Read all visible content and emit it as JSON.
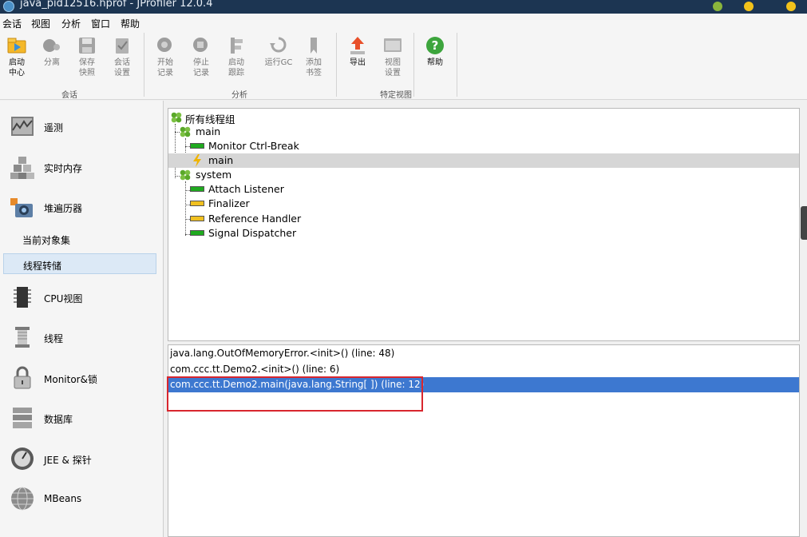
{
  "window": {
    "title": "java_pid12516.hprof - JProfiler 12.0.4"
  },
  "menubar": {
    "items": [
      "会话",
      "视图",
      "分析",
      "窗口",
      "帮助"
    ]
  },
  "toolbar": {
    "buttons": [
      {
        "label": "启动\n中心",
        "icon": "start-center-icon",
        "enabled": true
      },
      {
        "label": "分离",
        "icon": "detach-icon",
        "enabled": false
      },
      {
        "label": "保存\n快照",
        "icon": "save-snapshot-icon",
        "enabled": false
      },
      {
        "label": "会话\n设置",
        "icon": "session-settings-icon",
        "enabled": false
      },
      {
        "label": "开始\n记录",
        "icon": "start-recording-icon",
        "enabled": false
      },
      {
        "label": "停止\n记录",
        "icon": "stop-recording-icon",
        "enabled": false
      },
      {
        "label": "启动\n跟踪",
        "icon": "start-tracking-icon",
        "enabled": false
      },
      {
        "label": "运行GC",
        "icon": "run-gc-icon",
        "enabled": false
      },
      {
        "label": "添加\n书签",
        "icon": "add-bookmark-icon",
        "enabled": false
      },
      {
        "label": "导出",
        "icon": "export-icon",
        "enabled": true
      },
      {
        "label": "视图\n设置",
        "icon": "view-settings-icon",
        "enabled": false
      },
      {
        "label": "帮助",
        "icon": "help-icon",
        "enabled": true
      }
    ],
    "groups": [
      "会话",
      "分析",
      "特定视图"
    ]
  },
  "sidebar": {
    "items": [
      {
        "label": "遥测",
        "icon": "telemetry-icon"
      },
      {
        "label": "实时内存",
        "icon": "live-memory-icon"
      },
      {
        "label": "堆遍历器",
        "icon": "heap-walker-icon"
      },
      {
        "label": "CPU视图",
        "icon": "cpu-views-icon"
      },
      {
        "label": "线程",
        "icon": "threads-icon"
      },
      {
        "label": "Monitor&锁",
        "icon": "monitor-lock-icon"
      },
      {
        "label": "数据库",
        "icon": "database-icon"
      },
      {
        "label": "JEE & 探针",
        "icon": "jee-probes-icon"
      },
      {
        "label": "MBeans",
        "icon": "mbeans-icon"
      }
    ],
    "subitems": [
      {
        "label": "当前对象集",
        "selected": false
      },
      {
        "label": "线程转储",
        "selected": true
      }
    ]
  },
  "thread_tree": {
    "rows": [
      {
        "label": "所有线程组",
        "kind": "group"
      },
      {
        "label": "main",
        "kind": "group"
      },
      {
        "label": "Monitor Ctrl-Break",
        "kind": "thread",
        "state_color": "#1faa1f"
      },
      {
        "label": "main",
        "kind": "thread-current",
        "state_color": "#f0b400",
        "selected": true
      },
      {
        "label": "system",
        "kind": "group"
      },
      {
        "label": "Attach Listener",
        "kind": "thread",
        "state_color": "#1faa1f"
      },
      {
        "label": "Finalizer",
        "kind": "thread",
        "state_color": "#f0c020"
      },
      {
        "label": "Reference Handler",
        "kind": "thread",
        "state_color": "#f0c020"
      },
      {
        "label": "Signal Dispatcher",
        "kind": "thread",
        "state_color": "#1faa1f"
      }
    ]
  },
  "stack_trace": {
    "frames": [
      {
        "text": "java.lang.OutOfMemoryError.<init>() (line: 48)",
        "selected": false
      },
      {
        "text": "com.ccc.tt.Demo2.<init>() (line: 6)",
        "selected": false
      },
      {
        "text": "com.ccc.tt.Demo2.main(java.lang.String[ ]) (line: 12)",
        "selected": true
      }
    ]
  },
  "colors": {
    "selection": "#3d78d0",
    "highlight_box": "#d8262e",
    "titlebar": "#1c3552"
  }
}
